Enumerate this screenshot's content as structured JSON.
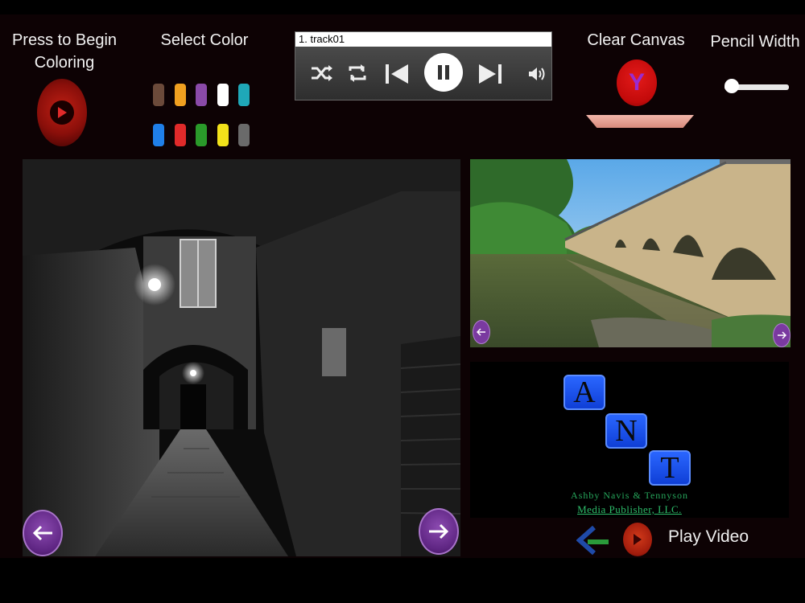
{
  "header": {
    "begin_label": "Press to Begin\nColoring",
    "select_color_label": "Select Color",
    "clear_canvas_label": "Clear Canvas",
    "clear_button_letter": "Y",
    "pencil_width_label": "Pencil Width",
    "pencil_width_value": 0.05
  },
  "palette": {
    "row1": [
      "#6b4a3a",
      "#f0a020",
      "#8a4aa8",
      "#ffffff",
      "#1fa8b8"
    ],
    "row2": [
      "#1f7fe8",
      "#e02a2a",
      "#2a9a2a",
      "#f2e21a",
      "#6a6a6a"
    ]
  },
  "player": {
    "track_label": "1.  track01",
    "state": "playing",
    "icons": [
      "shuffle-icon",
      "repeat-icon",
      "previous-icon",
      "pause-icon",
      "next-icon",
      "volume-icon"
    ]
  },
  "logo": {
    "letters": [
      "A",
      "N",
      "T"
    ],
    "company": "Ashby  Navis  &  Tennyson",
    "subtitle": "Media Publisher,  LLC."
  },
  "footer": {
    "play_video_label": "Play Video"
  },
  "colors": {
    "background": "#0d0204",
    "accent_red": "#c20a0a",
    "accent_purple": "#5e2582"
  }
}
